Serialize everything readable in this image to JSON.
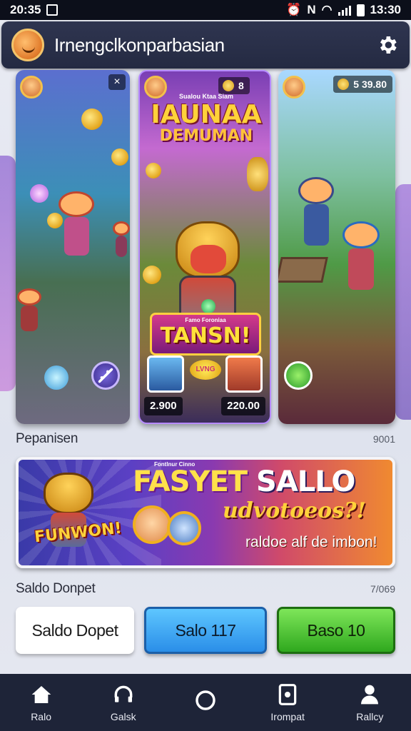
{
  "status_bar": {
    "time_left": "20:35",
    "time_right": "13:30"
  },
  "app_bar": {
    "title": "Irnengclkonparbasian",
    "avatar_icon": "fox-avatar-icon",
    "settings_icon": "gear-icon"
  },
  "cards": {
    "left": {
      "close_label": "×"
    },
    "center": {
      "header_small": "Sualou Ktaa Siam",
      "pill_text": "8",
      "title_line1": "IAUNAA",
      "title_line2": "DEMUMAN",
      "banner_small": "Famo Foroniaa",
      "banner_text": "TANSN!",
      "chip_text": "LVNG",
      "price_left": "2.900",
      "price_right": "220.00"
    },
    "right": {
      "pill_text": "5 39.80"
    }
  },
  "section1": {
    "label": "Pepanisen",
    "meta": "9001"
  },
  "promo": {
    "title_part1": "FASYET",
    "title_part2": "SALLO",
    "subtitle": "udvotoeos?!",
    "tagline": "raldoe alf de imbon!",
    "sticker": "FUNWON!",
    "kicker": "Fontlnur Cinno"
  },
  "section2": {
    "label": "Saldo Donpet",
    "meta": "7/069"
  },
  "buttons": {
    "white": "Saldo Dopet",
    "blue": "Salo 117",
    "green": "Baso 10"
  },
  "nav": [
    {
      "label": "Ralo",
      "icon": "home-icon"
    },
    {
      "label": "Galsk",
      "icon": "headset-icon"
    },
    {
      "label": "",
      "icon": "circle-icon"
    },
    {
      "label": "Irompat",
      "icon": "tablet-icon"
    },
    {
      "label": "Rallcy",
      "icon": "profile-icon"
    }
  ],
  "colors": {
    "appbar": "#2a304a",
    "navbar": "#1e2438",
    "btn_blue": "#2a8ee8",
    "btn_green": "#2fa81e"
  }
}
